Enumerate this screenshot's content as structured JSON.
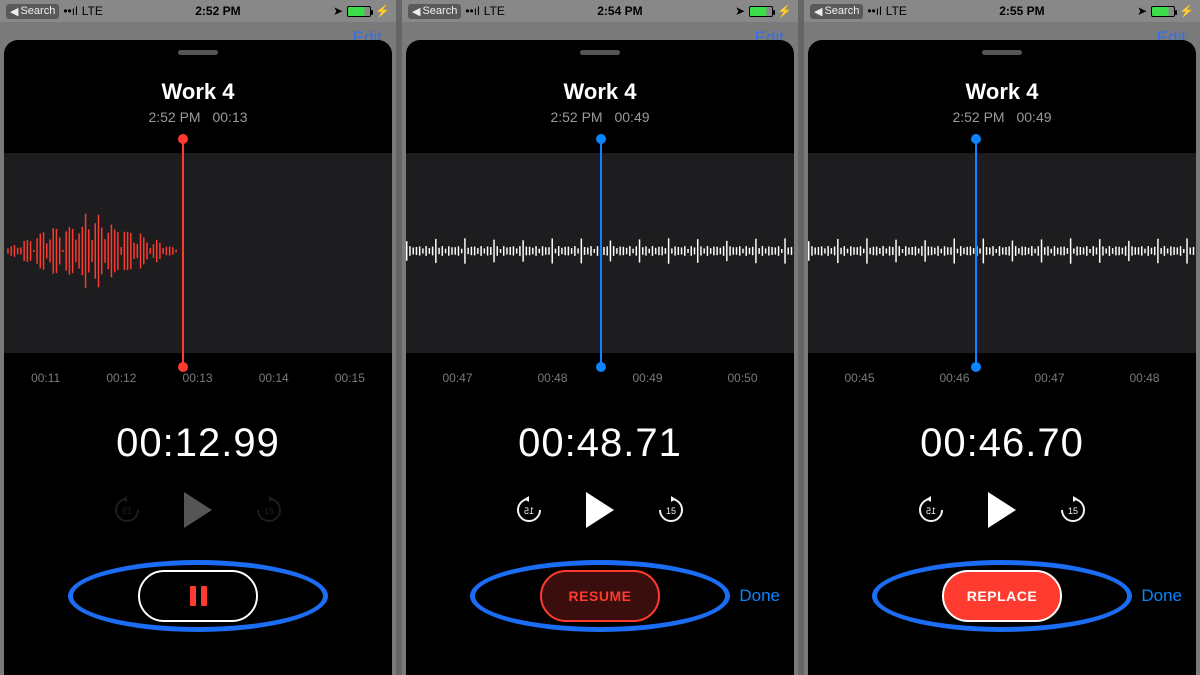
{
  "statusbar": {
    "back_label": "Search",
    "carrier": "LTE",
    "location_icon": "location-arrow",
    "charging": true
  },
  "screens": [
    {
      "status_time": "2:52 PM",
      "edit_label": "Edit",
      "title": "Work 4",
      "rec_time": "2:52 PM",
      "duration": "00:13",
      "show_crop": false,
      "waveform_color": "#ff3b30",
      "waveform_style": "recording",
      "playhead_color": "red",
      "playhead_pct": 46,
      "ruler": [
        "00:11",
        "00:12",
        "00:13",
        "00:14",
        "00:15"
      ],
      "elapsed": "00:12.99",
      "controls_dim": true,
      "action": {
        "type": "pause"
      },
      "done_label": null
    },
    {
      "status_time": "2:54 PM",
      "edit_label": "Edit",
      "title": "Work 4",
      "rec_time": "2:52 PM",
      "duration": "00:49",
      "show_crop": true,
      "waveform_color": "#ffffff",
      "waveform_style": "quiet",
      "playhead_color": "blue",
      "playhead_pct": 50,
      "ruler": [
        "00:47",
        "00:48",
        "00:49",
        "00:50"
      ],
      "elapsed": "00:48.71",
      "controls_dim": false,
      "action": {
        "type": "resume",
        "label": "RESUME"
      },
      "done_label": "Done"
    },
    {
      "status_time": "2:55 PM",
      "edit_label": "Edit",
      "title": "Work 4",
      "rec_time": "2:52 PM",
      "duration": "00:49",
      "show_crop": true,
      "waveform_color": "#ffffff",
      "waveform_style": "quiet",
      "playhead_color": "blue",
      "playhead_pct": 43,
      "ruler": [
        "00:45",
        "00:46",
        "00:47",
        "00:48"
      ],
      "elapsed": "00:46.70",
      "controls_dim": false,
      "action": {
        "type": "replace",
        "label": "REPLACE"
      },
      "done_label": "Done"
    }
  ],
  "labels": {
    "skip_seconds": "15"
  }
}
